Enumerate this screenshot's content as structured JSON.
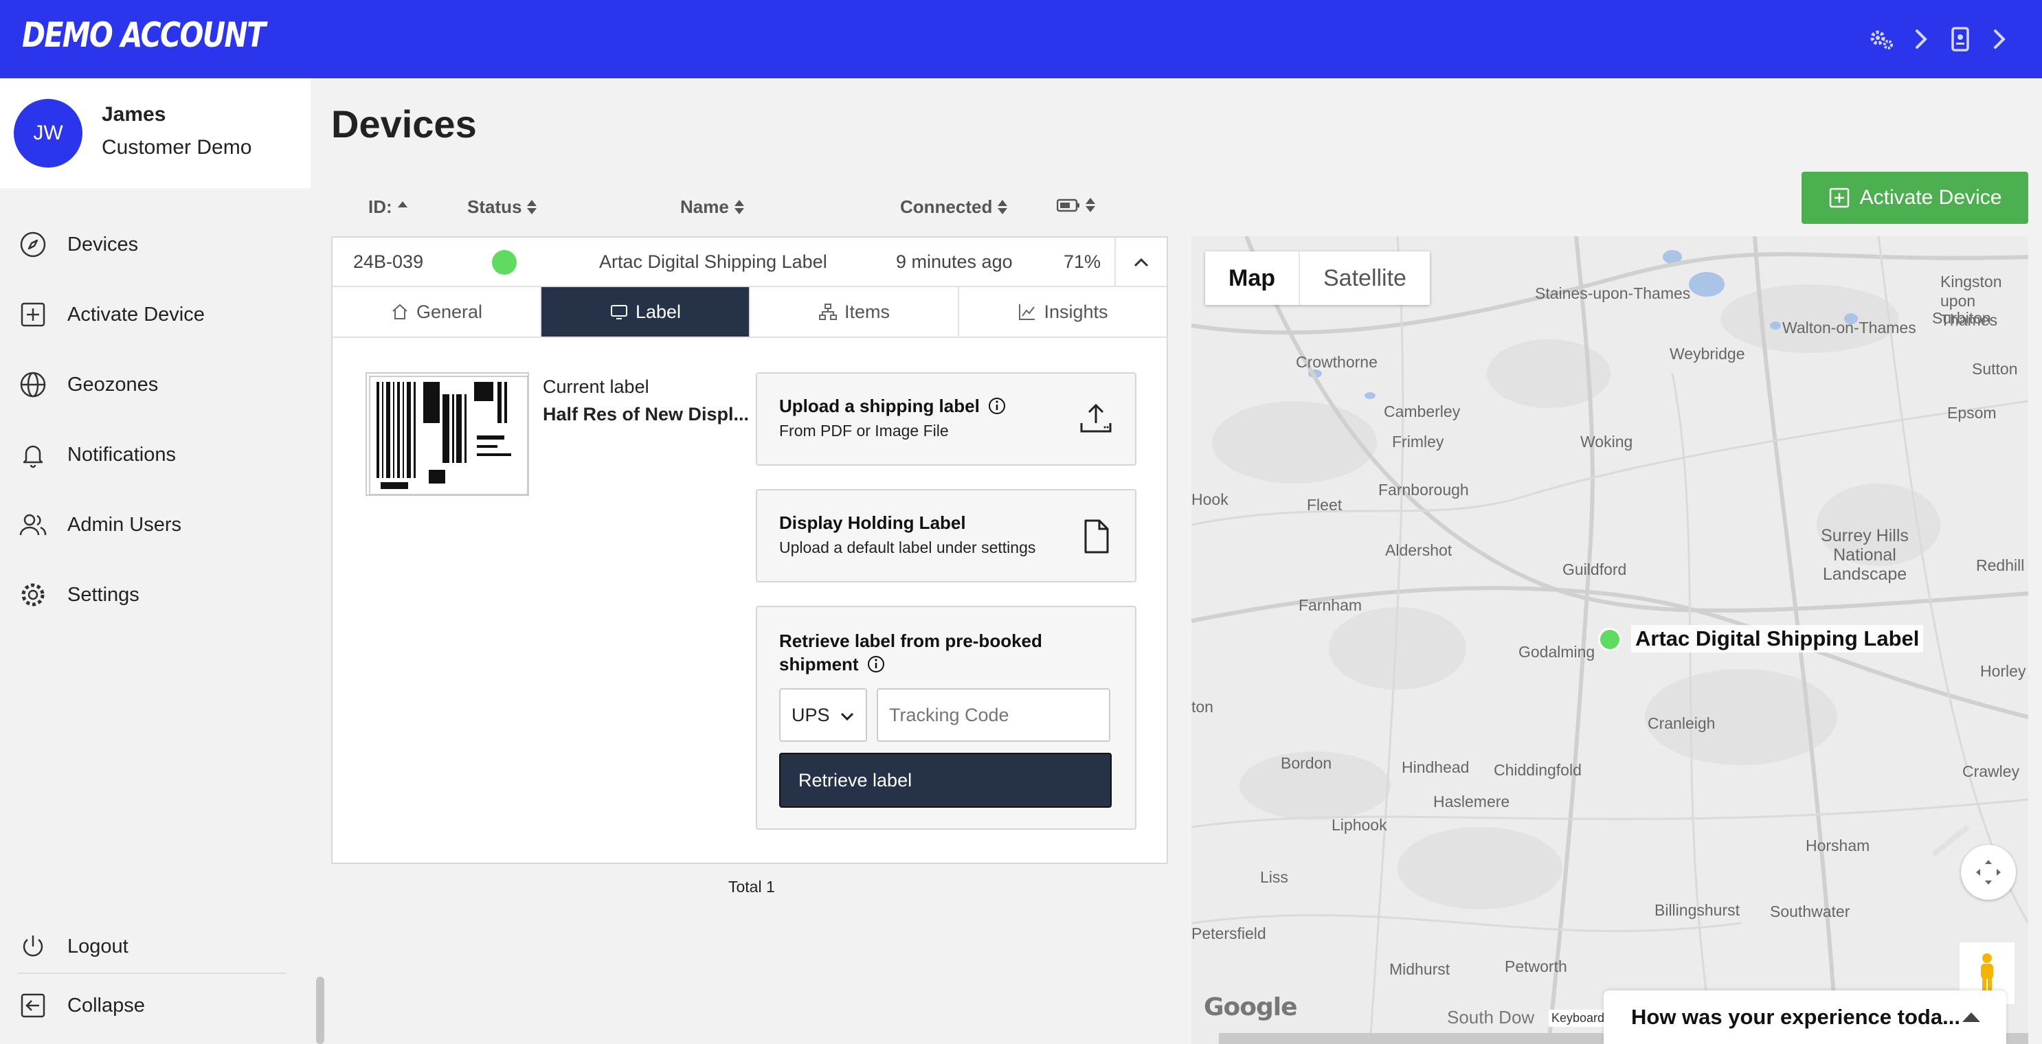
{
  "header": {
    "brand": "DEMO ACCOUNT",
    "icons": [
      "gears-icon",
      "chevron-right-icon",
      "id-badge-icon",
      "chevron-right-icon"
    ]
  },
  "user": {
    "initials": "JW",
    "name": "James",
    "role": "Customer Demo"
  },
  "sidebar": {
    "items": [
      {
        "label": "Devices",
        "icon": "compass-icon"
      },
      {
        "label": "Activate Device",
        "icon": "plus-square-icon"
      },
      {
        "label": "Geozones",
        "icon": "globe-icon"
      },
      {
        "label": "Notifications",
        "icon": "bell-icon"
      },
      {
        "label": "Admin Users",
        "icon": "users-icon"
      },
      {
        "label": "Settings",
        "icon": "gear-icon"
      }
    ],
    "logout": "Logout",
    "collapse": "Collapse"
  },
  "page": {
    "title": "Devices",
    "activate_button": "Activate Device",
    "total": "Total 1"
  },
  "table": {
    "columns": [
      "ID:",
      "Status",
      "Name",
      "Connected",
      ""
    ],
    "rows": [
      {
        "id": "24B-039",
        "status_color": "#5fdc5f",
        "name": "Artac Digital Shipping Label",
        "connected": "9 minutes ago",
        "battery": "71%"
      }
    ]
  },
  "device_tabs": {
    "items": [
      "General",
      "Label",
      "Items",
      "Insights"
    ],
    "active": "Label"
  },
  "label_panel": {
    "current_label_caption": "Current label",
    "current_label_name": "Half Res of New Displ...",
    "upload": {
      "title": "Upload a shipping label",
      "subtitle": "From PDF or Image File"
    },
    "holding": {
      "title": "Display Holding Label",
      "subtitle": "Upload a default label under settings"
    },
    "retrieve": {
      "title_line1": "Retrieve label from pre-booked",
      "title_line2": "shipment",
      "carrier": "UPS",
      "tracking_placeholder": "Tracking Code",
      "button": "Retrieve label"
    }
  },
  "map": {
    "type_map": "Map",
    "type_satellite": "Satellite",
    "marker_label": "Artac Digital Shipping Label",
    "places": [
      "Staines-upon-Thames",
      "Kingston upon Thames",
      "Walton-on-Thames",
      "Surbiton",
      "Weybridge",
      "Crowthorne",
      "Sutton",
      "Epsom",
      "Camberley",
      "Frimley",
      "Woking",
      "Farnborough",
      "Fleet",
      "Hook",
      "Aldershot",
      "Guildford",
      "Surrey Hills National Landscape",
      "Redhill",
      "Farnham",
      "Godalming",
      "Horley",
      "Cranleigh",
      "Crawley",
      "Bordon",
      "Hindhead",
      "Chiddingfold",
      "Haslemere",
      "Liphook",
      "Horsham",
      "Liss",
      "Billingshurst",
      "Southwater",
      "Petersfield",
      "Petworth",
      "Midhurst",
      "South Dow",
      "ton"
    ],
    "footer_text": "Keyboard",
    "logo": "Google"
  },
  "feedback": {
    "text": "How was your experience toda..."
  },
  "colors": {
    "topbar": "#2b36ec",
    "active_tab": "#253248",
    "activate_button": "#4caf50",
    "status_online": "#5fdc5f"
  }
}
